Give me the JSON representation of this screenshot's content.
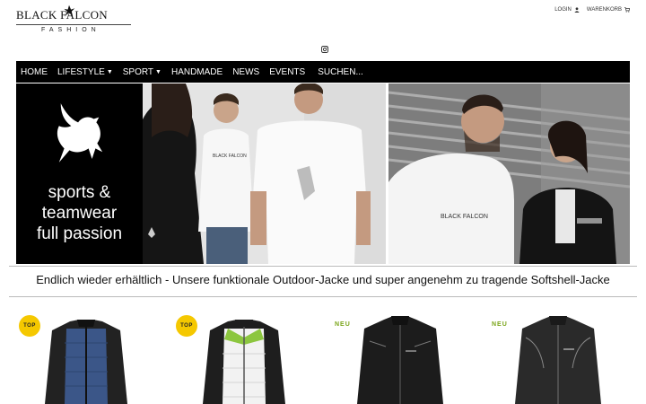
{
  "logo": {
    "main": "BLACK FALCON",
    "sub": "FASHION"
  },
  "header_links": {
    "login": "LOGIN",
    "cart": "WARENKORB"
  },
  "nav": {
    "items": [
      {
        "label": "HOME",
        "dropdown": false
      },
      {
        "label": "LIFESTYLE",
        "dropdown": true
      },
      {
        "label": "SPORT",
        "dropdown": true
      },
      {
        "label": "HANDMADE",
        "dropdown": false
      },
      {
        "label": "NEWS",
        "dropdown": false
      },
      {
        "label": "EVENTS",
        "dropdown": false
      }
    ],
    "search": "SUCHEN..."
  },
  "hero": {
    "slogan": [
      "sports &",
      "teamwear",
      "full passion"
    ],
    "shirt_print": "BLACK FALCON",
    "shirt_print_2": "BLACK FALCON"
  },
  "headline": "Endlich wieder erhältlich - Unsere funktionale Outdoor-Jacke und super angenehm zu tragende Softshell-Jacke",
  "products": [
    {
      "badge": "TOP",
      "badge_type": "top",
      "body": "#3b5688",
      "sleeve": "#222222"
    },
    {
      "badge": "TOP",
      "badge_type": "top",
      "body": "#f2f2f2",
      "sleeve": "#1e1e1e",
      "accent": "#8cc63f"
    },
    {
      "badge": "NEU",
      "badge_type": "neu",
      "body": "#1c1c1c",
      "sleeve": "#1c1c1c"
    },
    {
      "badge": "NEU",
      "badge_type": "neu",
      "body": "#2a2a2a",
      "sleeve": "#2a2a2a"
    }
  ],
  "colors": {
    "nav_bg": "#000000",
    "badge_top": "#f5c800",
    "badge_neu": "#7aa51a"
  }
}
